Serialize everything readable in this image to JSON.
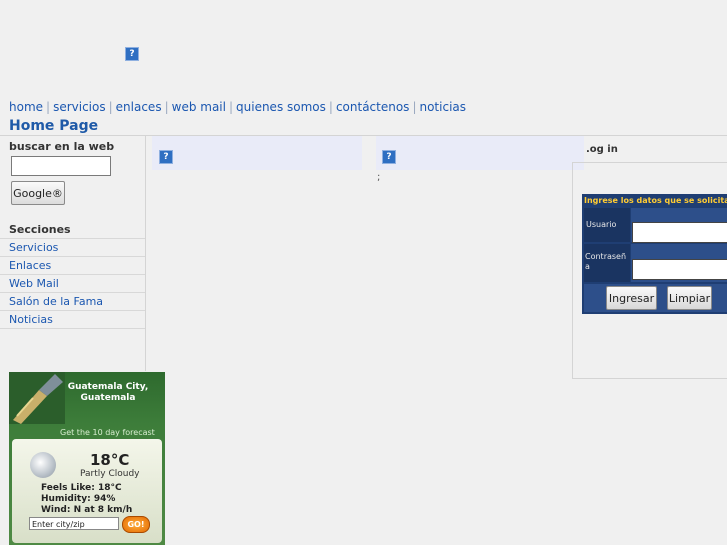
{
  "nav": {
    "items": [
      "home",
      "servicios",
      "enlaces",
      "web mail",
      "quienes somos",
      "contáctenos",
      "noticias"
    ]
  },
  "page_title": "Home Page",
  "search": {
    "label": "buscar en la web",
    "button": "Google®"
  },
  "sections": {
    "heading": "Secciones",
    "items": [
      "Servicios",
      "Enlaces",
      "Web Mail",
      "Salón de la Fama",
      "Noticias"
    ]
  },
  "middle": {
    "semicolon": ";"
  },
  "login": {
    "title": ".og in",
    "header": "Ingrese los datos que se solicita",
    "user_label": "Usuario",
    "pass_label": "Contraseña",
    "submit": "Ingresar",
    "reset": "Limpiar"
  },
  "weather": {
    "city": "Guatemala City, Guatemala",
    "forecast_link": "Get the 10 day forecast",
    "temp": "18°C",
    "condition": "Partly Cloudy",
    "feels_like": "Feels Like: 18°C",
    "humidity": "Humidity: 94%",
    "wind": "Wind: N at 8 km/h",
    "city_input_placeholder": "Enter city/zip",
    "go": "GO!"
  },
  "icons": {
    "broken_image": "broken-image-icon"
  },
  "colors": {
    "link": "#1b57b0",
    "title": "#1f5aa8",
    "login_bg": "#1f3e73",
    "login_header": "#ffcc33"
  }
}
